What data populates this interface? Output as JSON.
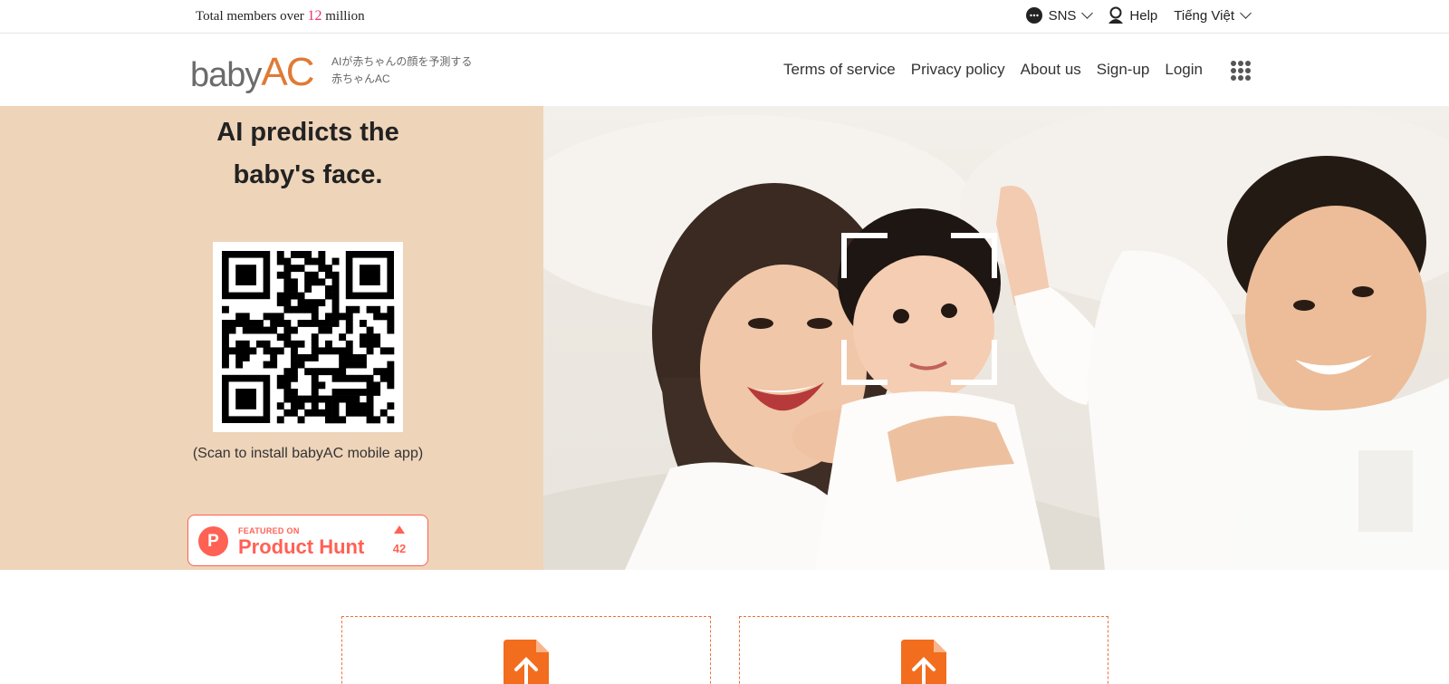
{
  "topbar": {
    "members_prefix": "Total members over",
    "members_count": "12",
    "members_suffix": "million",
    "sns_label": "SNS",
    "help_label": "Help",
    "language_label": "Tiếng Việt"
  },
  "header": {
    "logo_baby": "baby",
    "logo_ac": "AC",
    "tagline_line1": "AIが赤ちゃんの顔を予測する",
    "tagline_line2": "赤ちゃんAC",
    "nav": {
      "terms": "Terms of service",
      "privacy": "Privacy policy",
      "about": "About us",
      "signup": "Sign-up",
      "login": "Login"
    }
  },
  "hero": {
    "title_line1": "AI predicts the",
    "title_line2": "baby's face.",
    "qr_caption": "(Scan to install babyAC mobile app)",
    "product_hunt": {
      "featured": "FEATURED ON",
      "name": "Product Hunt",
      "count": "42"
    }
  },
  "colors": {
    "accent": "#e07a36",
    "hero_left_bg": "#eed4b9",
    "members_count": "#e8336a",
    "product_hunt": "#ff6154",
    "upload_border": "#f0703a"
  },
  "icons": [
    "sns-chat-icon",
    "help-person-icon",
    "chevron-down-icon",
    "apps-grid-icon",
    "product-hunt-icon",
    "upvote-icon",
    "upload-file-icon"
  ]
}
